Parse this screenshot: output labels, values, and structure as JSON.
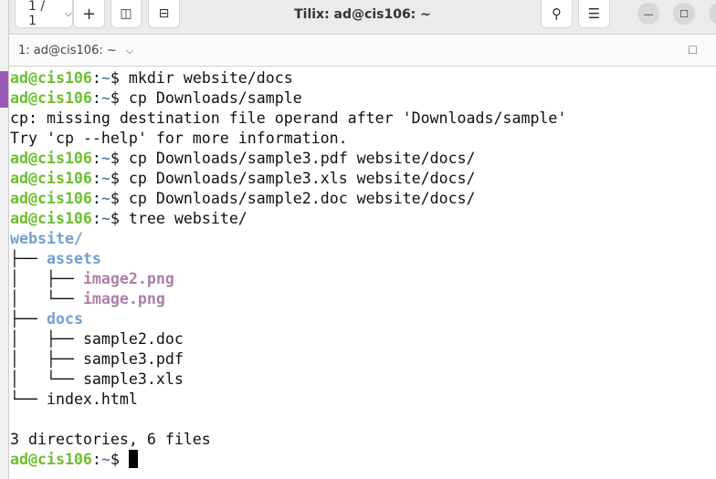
{
  "window": {
    "title": "Tilix: ad@cis106: ~",
    "session_selector": "1 / 1",
    "tab_label": "1: ad@cis106: ~"
  },
  "prompt": {
    "user_host": "ad@cis106",
    "path": "~",
    "symbol": "$"
  },
  "lines": [
    {
      "type": "cmd",
      "text": "mkdir website/docs"
    },
    {
      "type": "cmd",
      "text": "cp Downloads/sample"
    },
    {
      "type": "out",
      "text": "cp: missing destination file operand after 'Downloads/sample'"
    },
    {
      "type": "out",
      "text": "Try 'cp --help' for more information."
    },
    {
      "type": "cmd",
      "text": "cp Downloads/sample3.pdf website/docs/"
    },
    {
      "type": "cmd",
      "text": "cp Downloads/sample3.xls website/docs/"
    },
    {
      "type": "cmd",
      "text": "cp Downloads/sample2.doc website/docs/"
    },
    {
      "type": "cmd",
      "text": "tree website/"
    },
    {
      "type": "tree",
      "prefix": "",
      "name": "website/",
      "kind": "dir"
    },
    {
      "type": "tree",
      "prefix": "├── ",
      "name": "assets",
      "kind": "dir"
    },
    {
      "type": "tree",
      "prefix": "│   ├── ",
      "name": "image2.png",
      "kind": "img"
    },
    {
      "type": "tree",
      "prefix": "│   └── ",
      "name": "image.png",
      "kind": "img"
    },
    {
      "type": "tree",
      "prefix": "├── ",
      "name": "docs",
      "kind": "dir"
    },
    {
      "type": "tree",
      "prefix": "│   ├── ",
      "name": "sample2.doc",
      "kind": "file"
    },
    {
      "type": "tree",
      "prefix": "│   ├── ",
      "name": "sample3.pdf",
      "kind": "file"
    },
    {
      "type": "tree",
      "prefix": "│   └── ",
      "name": "sample3.xls",
      "kind": "file"
    },
    {
      "type": "tree",
      "prefix": "└── ",
      "name": "index.html",
      "kind": "file"
    },
    {
      "type": "out",
      "text": ""
    },
    {
      "type": "out",
      "text": "3 directories, 6 files"
    },
    {
      "type": "prompt",
      "text": ""
    }
  ],
  "colors": {
    "prompt": "#6cbf2e",
    "dir": "#729fcf",
    "image": "#ad7fa8",
    "path": "#3465a4"
  },
  "icons": [
    "chevron-down-icon",
    "plus-icon",
    "add-terminal-right-icon",
    "add-terminal-down-icon",
    "search-icon",
    "menu-icon",
    "minimize-icon",
    "maximize-icon",
    "close-icon"
  ]
}
